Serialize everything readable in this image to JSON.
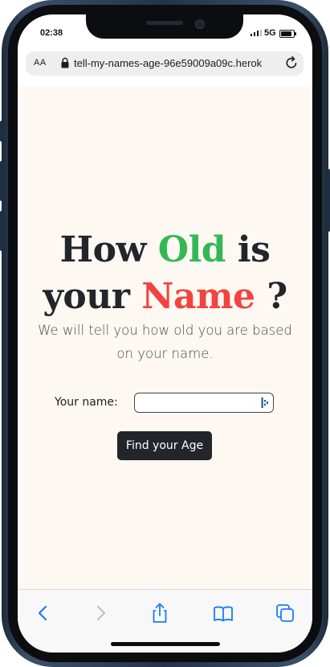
{
  "status_bar": {
    "time": "02:38",
    "network": "5G",
    "signal_icon": "signal-icon",
    "battery_icon": "battery-icon"
  },
  "browser": {
    "text_size_label": "AA",
    "url": "tell-my-names-age-96e59009a09c.herok",
    "lock_icon": "lock-icon",
    "reload_icon": "reload-icon"
  },
  "page": {
    "heading": {
      "word1": "How",
      "word2": "Old",
      "word3": "is",
      "word4": "your",
      "word5": "Name",
      "word6": "?"
    },
    "subtitle": "We will tell you how old you are based on your name.",
    "form": {
      "name_label": "Your name:",
      "name_value": "",
      "name_placeholder": "",
      "submit_label": "Find your Age"
    }
  },
  "toolbar": {
    "items": [
      "back-icon",
      "forward-icon",
      "share-icon",
      "bookmarks-icon",
      "tabs-icon"
    ]
  },
  "colors": {
    "accent_green": "#34b856",
    "accent_red": "#f1433f",
    "button_bg": "#23252b",
    "page_bg": "#fdf8f2",
    "ios_blue": "#1a7cf5"
  }
}
